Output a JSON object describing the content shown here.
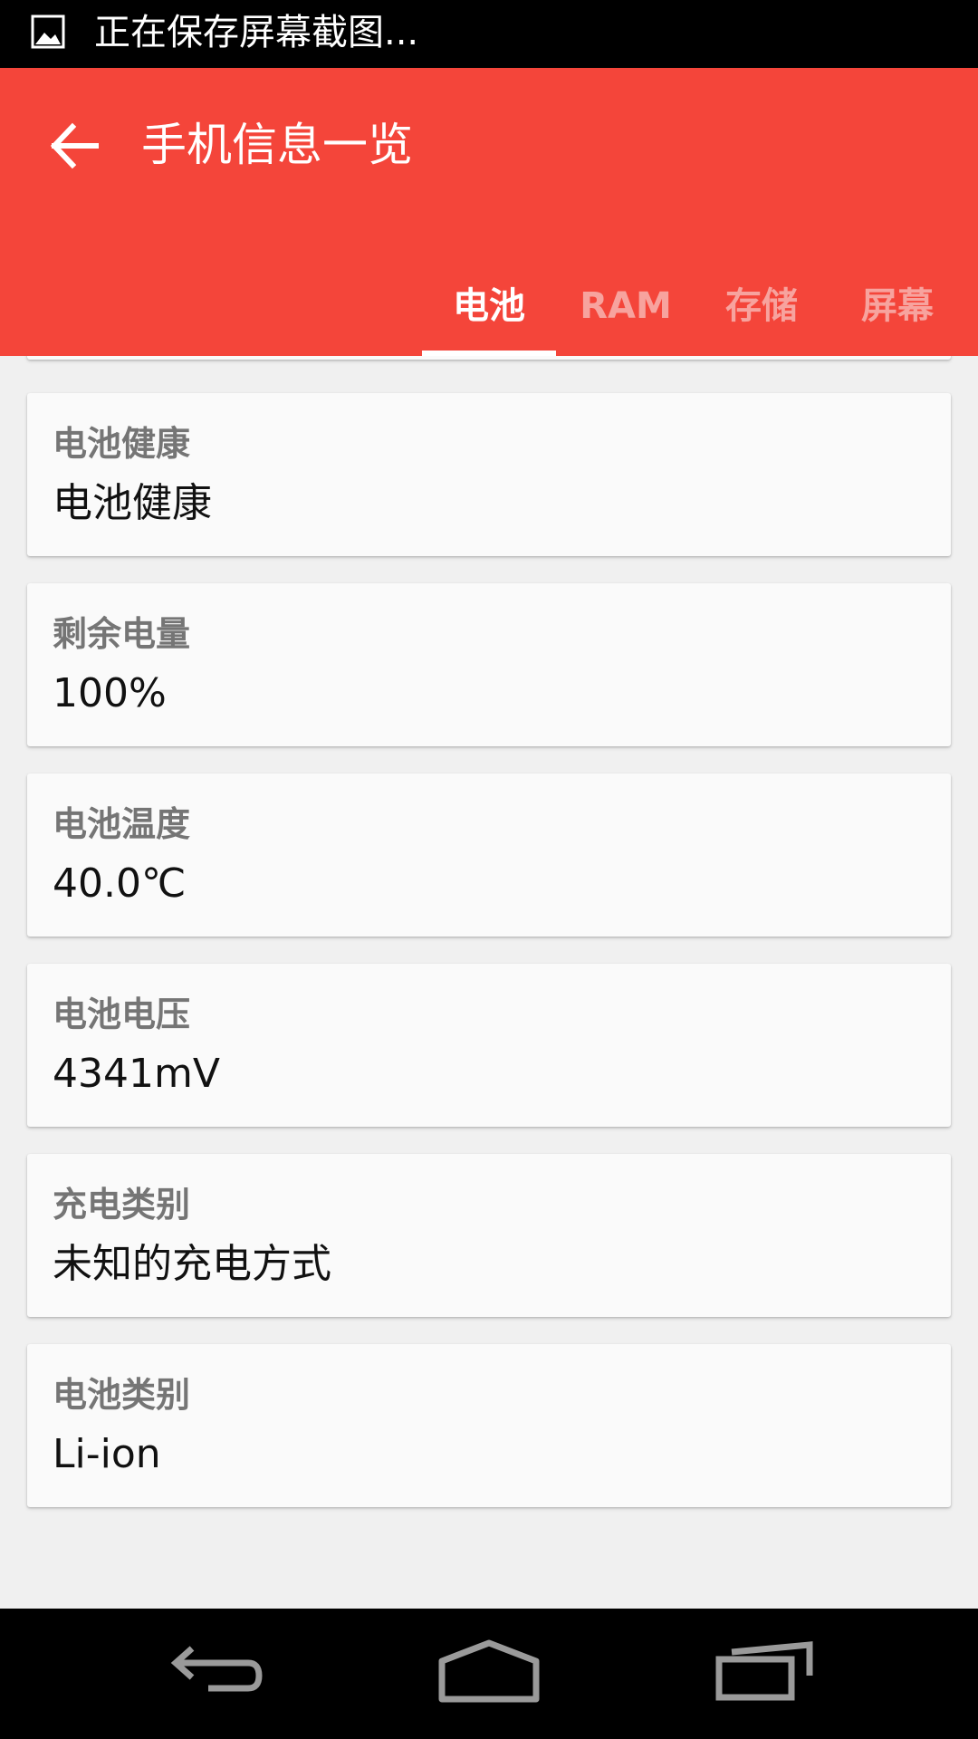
{
  "status_bar": {
    "notification_icon": "image-icon",
    "text": "正在保存屏幕截图..."
  },
  "app_bar": {
    "back_icon": "arrow-left-icon",
    "title": "手机信息一览",
    "background_color": "#f4453a",
    "tabs": [
      {
        "label": "电池",
        "selected": true
      },
      {
        "label": "RAM",
        "selected": false
      },
      {
        "label": "存储",
        "selected": false
      },
      {
        "label": "屏幕",
        "selected": false
      }
    ]
  },
  "cards": [
    {
      "label": "电池健康",
      "value": "电池健康"
    },
    {
      "label": "剩余电量",
      "value": "100%"
    },
    {
      "label": "电池温度",
      "value": "40.0℃"
    },
    {
      "label": "电池电压",
      "value": "4341mV"
    },
    {
      "label": "充电类别",
      "value": "未知的充电方式"
    },
    {
      "label": "电池类别",
      "value": "Li-ion"
    }
  ],
  "nav_bar": {
    "back_icon": "nav-back-icon",
    "home_icon": "nav-home-icon",
    "recents_icon": "nav-recents-icon"
  }
}
